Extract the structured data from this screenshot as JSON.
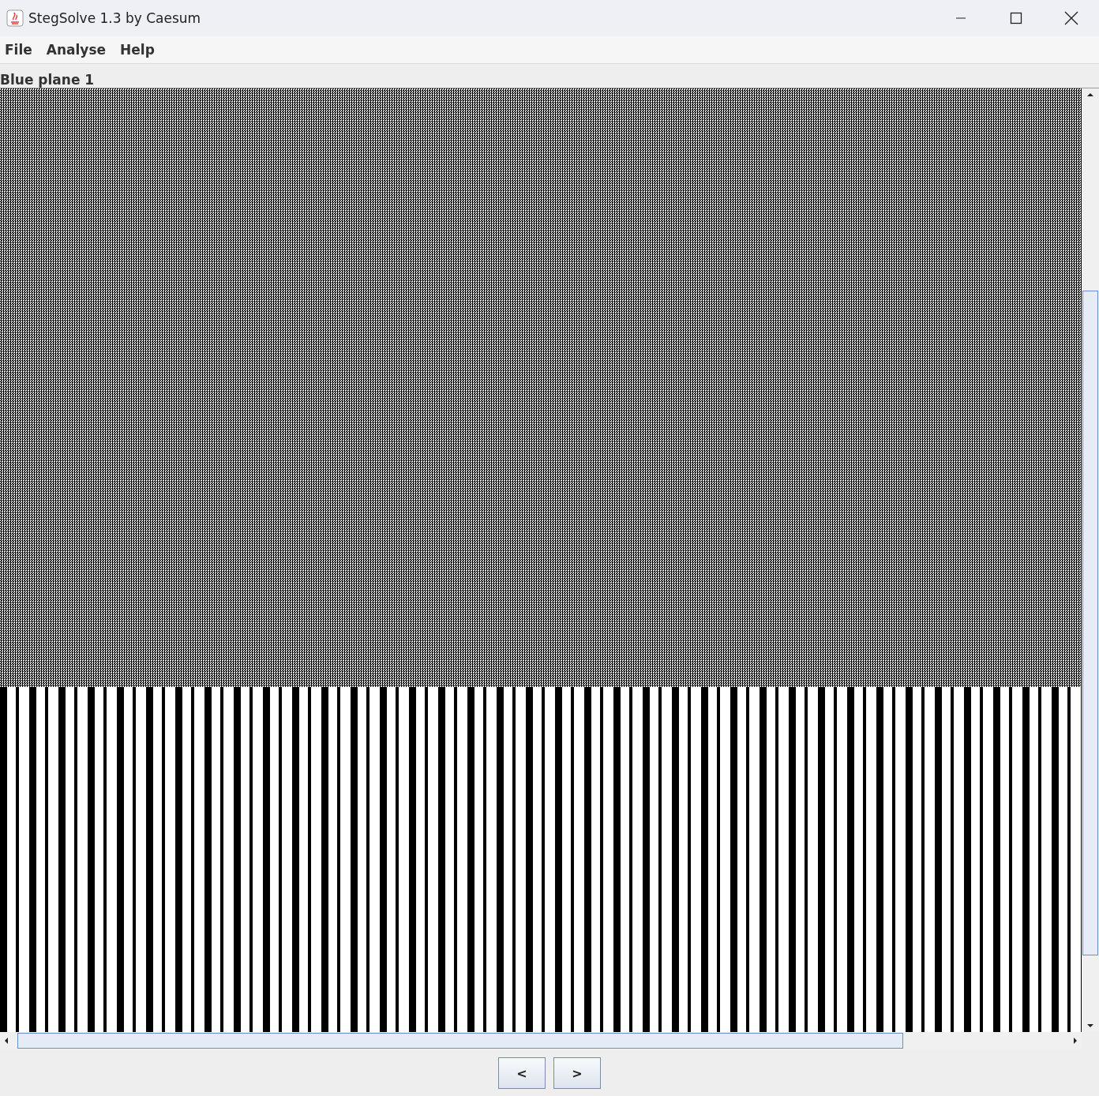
{
  "window": {
    "title": "StegSolve 1.3 by Caesum"
  },
  "menu": [
    {
      "label": "File"
    },
    {
      "label": "Analyse"
    },
    {
      "label": "Help"
    }
  ],
  "plane_label": "Blue plane 1",
  "buttons": [
    {
      "label": "<"
    },
    {
      "label": ">"
    }
  ]
}
